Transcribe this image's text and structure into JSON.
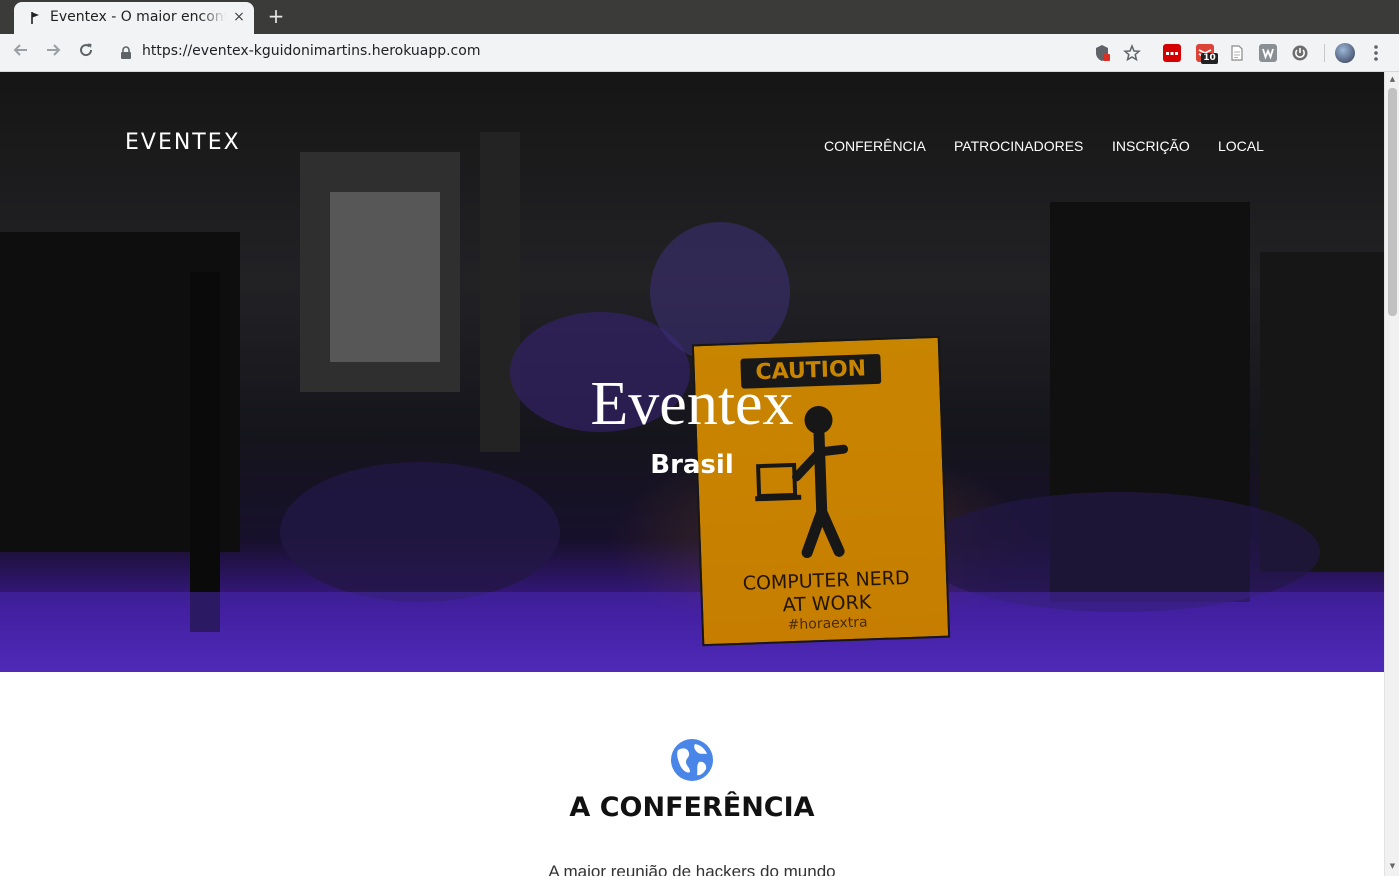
{
  "browser": {
    "tab_title": "Eventex - O maior encontro",
    "tab_close": "×",
    "new_tab": "+",
    "url": "https://eventex-kguidonimartins.herokuapp.com",
    "extension_badge": "10"
  },
  "page": {
    "brand": "EVENTEX",
    "nav": [
      "CONFERÊNCIA",
      "PATROCINADORES",
      "INSCRIÇÃO",
      "LOCAL"
    ],
    "hero": {
      "title": "Eventex",
      "subtitle": "Brasil",
      "sign_caution": "CAUTION",
      "sign_text_line1": "COMPUTER NERD",
      "sign_text_line2": "AT WORK",
      "sign_tag": "#horaextra"
    },
    "conference": {
      "title": "A CONFERÊNCIA",
      "text": "A maior reunião de hackers do mundo"
    }
  },
  "colors": {
    "hero_purple": "#6a3af0",
    "sign_orange": "#f4a300",
    "globe_blue": "#4a86e8"
  }
}
